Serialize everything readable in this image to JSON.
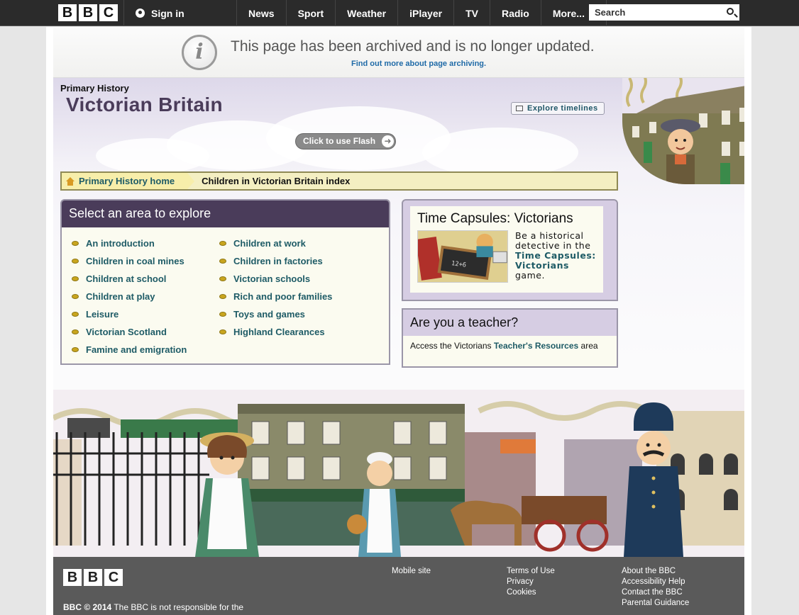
{
  "topbar": {
    "logo_letters": [
      "B",
      "B",
      "C"
    ],
    "signin_label": "Sign in",
    "nav": [
      "News",
      "Sport",
      "Weather",
      "iPlayer",
      "TV",
      "Radio",
      "More..."
    ],
    "search_placeholder": "Search"
  },
  "archive": {
    "icon_glyph": "i",
    "message": "This page has been archived and is no longer updated.",
    "link": "Find out more about page archiving."
  },
  "header": {
    "kicker": "Primary History",
    "title": "Victorian Britain",
    "timelines_label": "Explore timelines",
    "flash_label": "Click to use Flash",
    "flash_arrow": "➜"
  },
  "breadcrumb": {
    "home": "Primary History home",
    "current": "Children in Victorian Britain index"
  },
  "explore": {
    "heading": "Select an area to explore",
    "left": [
      "An introduction",
      "Children in coal mines",
      "Children at school",
      "Children at play",
      "Leisure",
      "Victorian Scotland",
      "Famine and emigration"
    ],
    "right": [
      "Children at work",
      "Children in factories",
      "Victorian schools",
      "Rich and poor families",
      "Toys and games",
      "Highland Clearances"
    ]
  },
  "capsules": {
    "title": "Time Capsules: Victorians",
    "text_before": "Be a historical detective in the ",
    "link": "Time Capsules: Victorians",
    "text_after": " game."
  },
  "teacher": {
    "heading": "Are you a teacher?",
    "text_before": "Access the Victorians ",
    "link": "Teacher's Resources",
    "text_after": " area"
  },
  "footer": {
    "copyright_bold": "BBC © 2014",
    "copyright_rest": " The BBC is not responsible for the",
    "col1": [
      "Mobile site"
    ],
    "col2": [
      "Terms of Use",
      "Privacy",
      "Cookies"
    ],
    "col3": [
      "About the BBC",
      "Accessibility Help",
      "Contact the BBC",
      "Parental Guidance"
    ]
  },
  "colors": {
    "purple_header": "#4a3c5a",
    "link_teal": "#1e5b66",
    "breadcrumb_bg": "#f4efc2",
    "footer_bg": "#5a5a5a"
  }
}
